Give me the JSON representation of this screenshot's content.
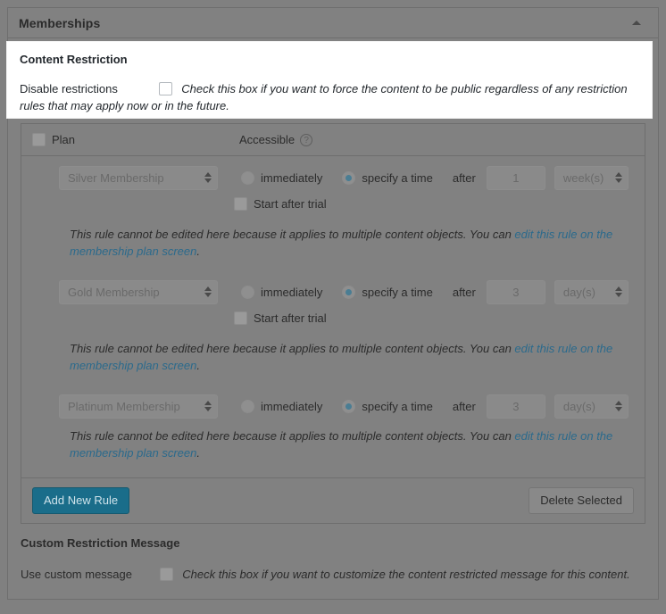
{
  "metabox": {
    "title": "Memberships",
    "collapse_icon": "caret-up-icon"
  },
  "content_restriction": {
    "section_title": "Content Restriction",
    "disable_label": "Disable restrictions",
    "disable_desc": "Check this box if you want to force the content to be public regardless of any restriction rules that may apply now or in the future.",
    "disable_checked": false
  },
  "rules_table": {
    "header": {
      "select_all_checked": false,
      "plan_col": "Plan",
      "accessible_col": "Accessible",
      "help_icon": "help-icon",
      "help_glyph": "?"
    },
    "notice_text_prefix": "This rule cannot be edited here because it applies to multiple content objects. You can ",
    "notice_link_1": "edit this rule on the",
    "notice_link_2": "membership plan screen",
    "notice_text_suffix": ".",
    "rules": [
      {
        "plan": "Silver Membership",
        "immediately_label": "immediately",
        "immediately_selected": false,
        "specify_label": "specify a time",
        "specify_selected": true,
        "after_label": "after",
        "amount": "1",
        "unit": "week(s)",
        "trial_label": "Start after trial",
        "trial_checked": false,
        "has_trial_row": true
      },
      {
        "plan": "Gold Membership",
        "immediately_label": "immediately",
        "immediately_selected": false,
        "specify_label": "specify a time",
        "specify_selected": true,
        "after_label": "after",
        "amount": "3",
        "unit": "day(s)",
        "trial_label": "Start after trial",
        "trial_checked": false,
        "has_trial_row": true
      },
      {
        "plan": "Platinum Membership",
        "immediately_label": "immediately",
        "immediately_selected": false,
        "specify_label": "specify a time",
        "specify_selected": true,
        "after_label": "after",
        "amount": "3",
        "unit": "day(s)",
        "trial_label": "",
        "trial_checked": false,
        "has_trial_row": false
      }
    ],
    "add_rule_button": "Add New Rule",
    "delete_selected_button": "Delete Selected"
  },
  "custom_message": {
    "section_title": "Custom Restriction Message",
    "use_label": "Use custom message",
    "use_desc": "Check this box if you want to customize the content restricted message for this content.",
    "use_checked": false
  },
  "colors": {
    "accent_button": "#1a6d8a",
    "link": "#2b6a8c",
    "radio_dot": "#4a7d93",
    "page_dim": "#808080",
    "spotlight": "#ffffff"
  }
}
